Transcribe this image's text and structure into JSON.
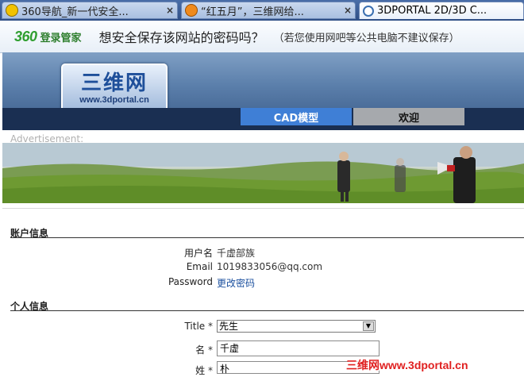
{
  "browser": {
    "tabs": [
      {
        "label": "360导航_新一代安全...",
        "close": "×",
        "active": false
      },
      {
        "label": "“红五月”，三维网给...",
        "close": "×",
        "active": false
      },
      {
        "label": "3DPORTAL 2D/3D C...",
        "active": true
      }
    ]
  },
  "password_bar": {
    "brand_number": "360",
    "brand_name": "登录管家",
    "question": "想安全保存该网站的密码吗？",
    "hint": "（若您使用网吧等公共电脑不建议保存）"
  },
  "site": {
    "logo_title": "三维网",
    "logo_url": "www.3dportal.cn",
    "nav": [
      "CAD模型",
      "欢迎"
    ],
    "ad_label": "Advertisement:"
  },
  "account": {
    "section_title": "账户信息",
    "username_label": "用户名",
    "username_value": "千虚部族",
    "email_label": "Email",
    "email_value": "1019833056@qq.com",
    "password_label": "Password",
    "password_link": "更改密码"
  },
  "personal": {
    "section_title": "个人信息",
    "title_label": "Title",
    "title_value": "先生",
    "first_name_label": "名",
    "first_name_value": "千虚",
    "last_name_label": "姓",
    "last_name_value": "朴",
    "required_mark": "*"
  },
  "watermark": "三维网www.3dportal.cn",
  "colors": {
    "nav_active": "#3f7fd6",
    "nav_inactive": "#a6a9ad",
    "brand_green": "#2f9e2f",
    "watermark": "#e02020"
  }
}
